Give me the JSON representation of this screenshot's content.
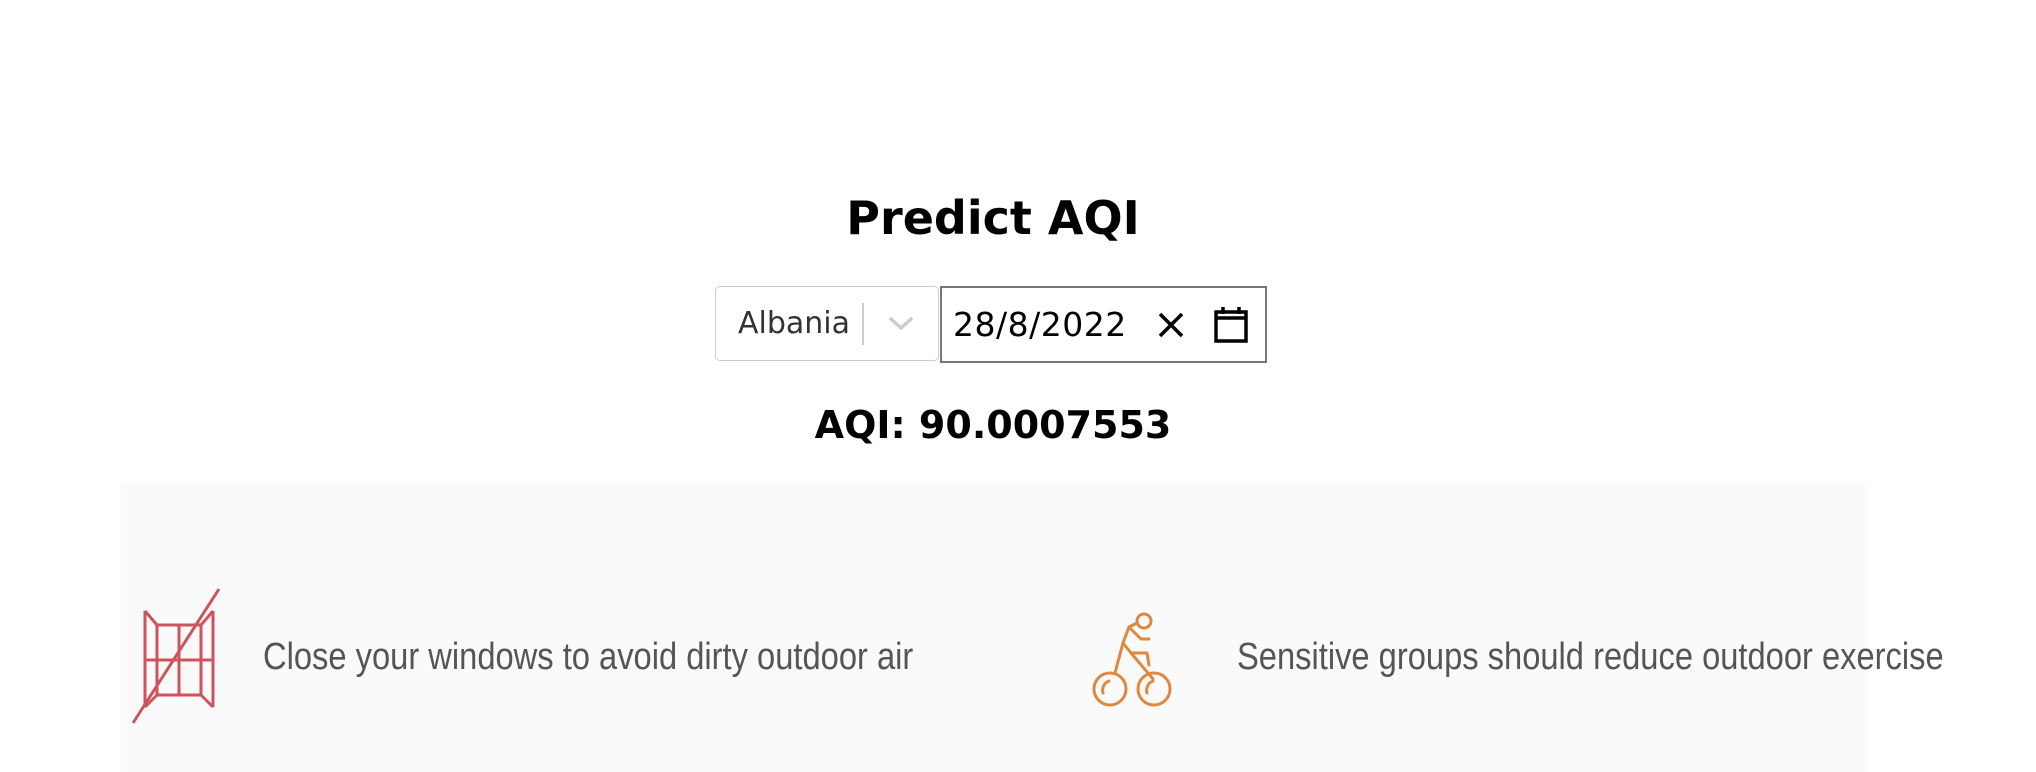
{
  "title": "Predict AQI",
  "country_select": {
    "value": "Albania"
  },
  "date_picker": {
    "value": "28/8/2022"
  },
  "aqi": {
    "label": "AQI: 90.0007553"
  },
  "recommendations": [
    {
      "icon": "closed-window-icon",
      "text": "Close your windows to avoid dirty outdoor air",
      "icon_color": "#d0525a"
    },
    {
      "icon": "cyclist-icon",
      "text": "Sensitive groups should reduce outdoor exercise",
      "icon_color": "#e08740"
    }
  ]
}
